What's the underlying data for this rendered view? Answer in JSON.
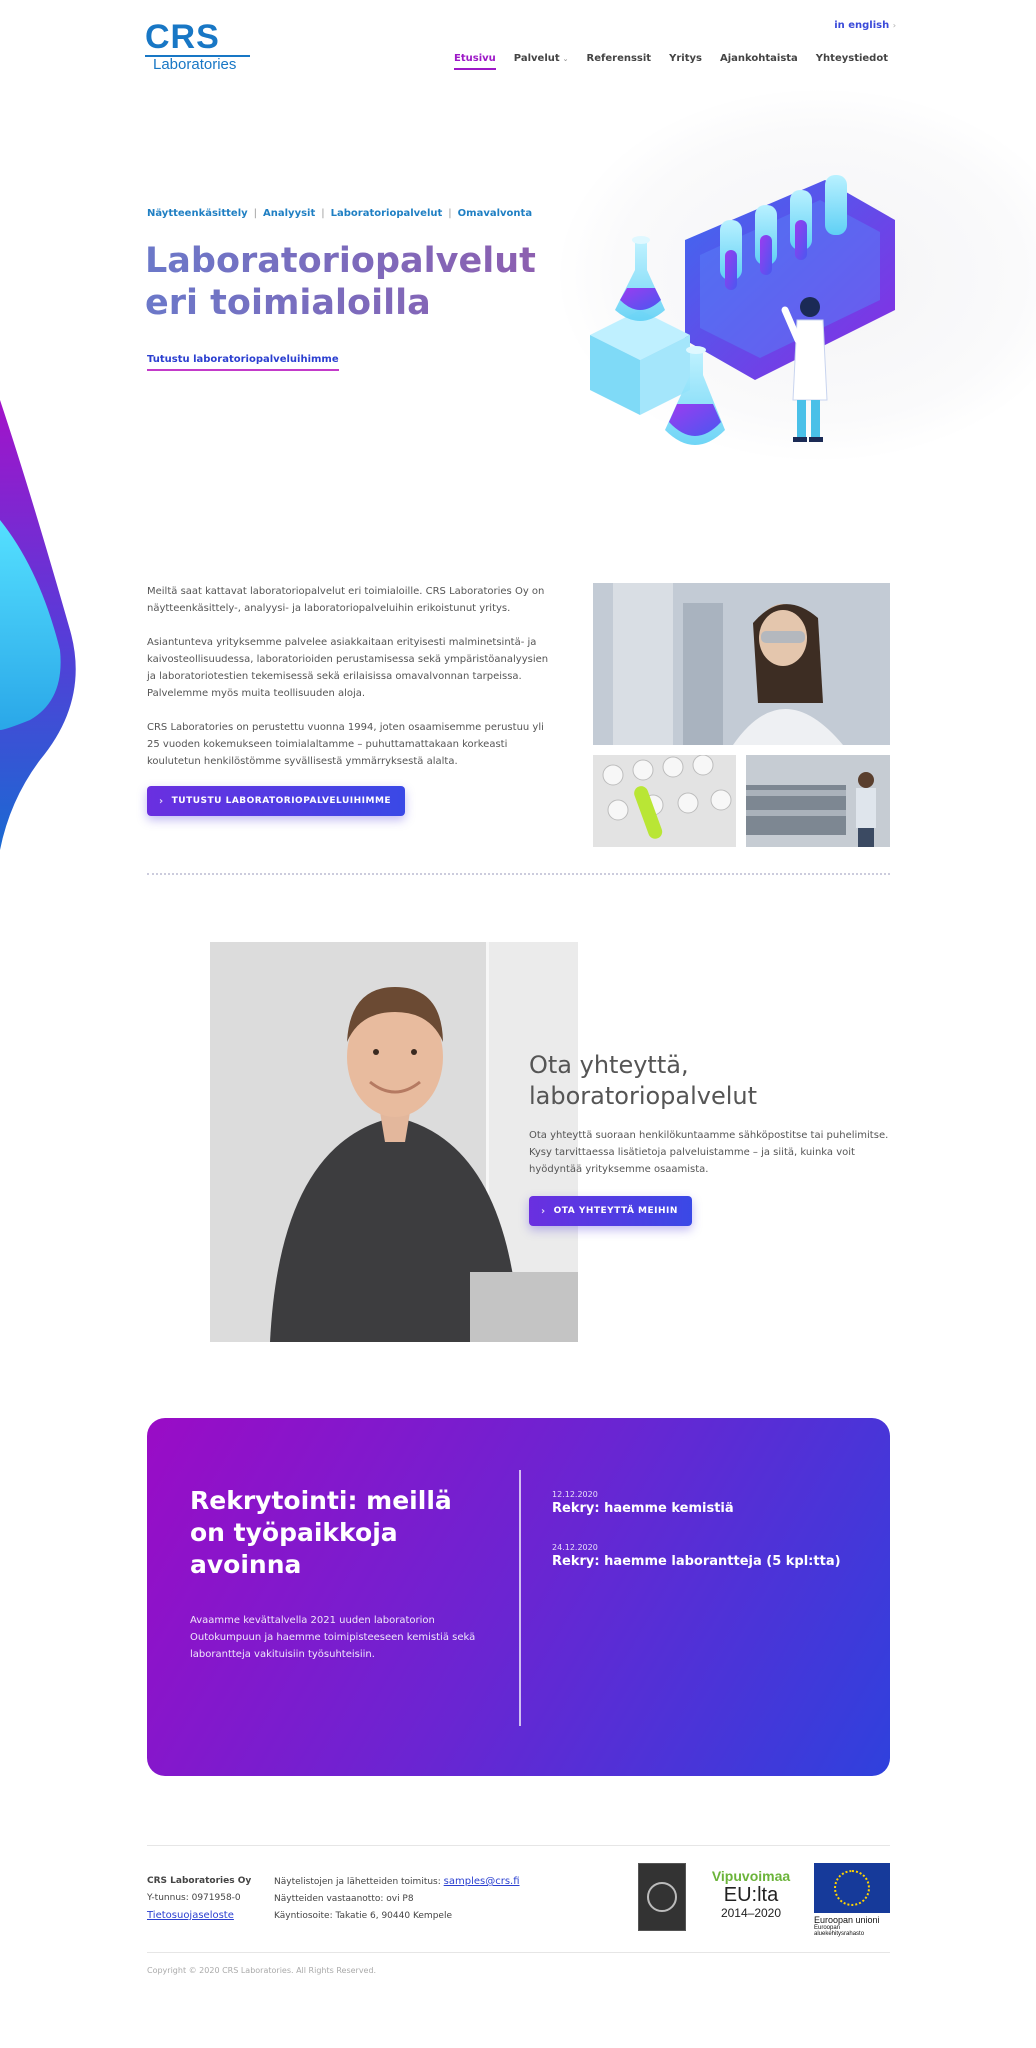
{
  "header": {
    "logo_main": "CRS",
    "logo_sub": "Laboratories",
    "language_link": "in english",
    "nav": [
      {
        "label": "Etusivu",
        "active": true
      },
      {
        "label": "Palvelut",
        "has_dropdown": true
      },
      {
        "label": "Referenssit"
      },
      {
        "label": "Yritys"
      },
      {
        "label": "Ajankohtaista"
      },
      {
        "label": "Yhteystiedot"
      }
    ]
  },
  "hero": {
    "breadcrumbs": [
      "Näytteenkäsittely",
      "Analyysit",
      "Laboratoriopalvelut",
      "Omavalvonta"
    ],
    "title_line1": "Laboratoriopalvelut",
    "title_line2": "eri toimialoilla",
    "link": "Tutustu laboratoriopalveluihimme"
  },
  "intro": {
    "p1": "Meiltä saat kattavat laboratoriopalvelut eri toimialoille. CRS Laboratories Oy on näytteenkäsittely-, analyysi- ja laboratoriopalveluihin erikoistunut yritys.",
    "p2": "Asiantunteva yrityksemme palvelee asiakkaitaan erityisesti malminetsintä- ja kaivosteollisuudessa, laboratorioiden perustamisessa sekä ympäristöanalyysien ja laboratoriotestien tekemisessä sekä erilaisissa omavalvonnan tarpeissa. Palvelemme myös muita teollisuuden aloja.",
    "p3": "CRS Laboratories on perustettu vuonna 1994, joten osaamisemme perustuu yli 25 vuoden kokemukseen toimialaltamme – puhuttamattakaan korkeasti koulutetun henkilöstömme syvällisestä ymmärryksestä alalta.",
    "button": "TUTUSTU LABORATORIOPALVELUIHIMME"
  },
  "contact": {
    "title_line1": "Ota yhteyttä,",
    "title_line2": "laboratoriopalvelut",
    "text": "Ota yhteyttä suoraan henkilökuntaamme sähköpostitse tai puhelimitse. Kysy tarvittaessa lisätietoja palveluistamme – ja siitä, kuinka voit hyödyntää yrityksemme osaamista.",
    "button": "OTA YHTEYTTÄ MEIHIN"
  },
  "recruitment": {
    "title": "Rekrytointi: meillä on työpaikkoja avoinna",
    "text": "Avaamme kevättalvella 2021 uuden laboratorion Outokumpuun ja haemme toimipisteeseen kemistiä sekä laborantteja vakituisiin työsuhteisiin.",
    "news": [
      {
        "date": "12.12.2020",
        "title": "Rekry: haemme kemistiä"
      },
      {
        "date": "24.12.2020",
        "title": "Rekry: haemme laborantteja (5 kpl:tta)"
      }
    ]
  },
  "footer": {
    "company": "CRS Laboratories Oy",
    "business_id": "Y-tunnus: 0971958-0",
    "privacy_link": "Tietosuojaseloste",
    "samples_label": "Näytelistojen ja lähetteiden toimitus:",
    "samples_email": "samples@crs.fi",
    "samples_receive": "Näytteiden vastaanotto: ovi P8",
    "address": "Käyntiosoite: Takatie 6, 90440 Kempele",
    "badge2_top": "Vipuvoimaa",
    "badge2_mid": "EU:lta",
    "badge2_bottom": "2014–2020",
    "badge3_title": "Euroopan unioni",
    "badge3_sub": "Euroopan aluekehitysrahasto",
    "copyright": "Copyright © 2020 CRS Laboratories. All Rights Reserved."
  },
  "colors": {
    "brand_blue": "#1877c5",
    "accent_purple": "#9d18c7",
    "button_gradient_start": "#6a2fe0",
    "button_gradient_end": "#3a49e6"
  }
}
